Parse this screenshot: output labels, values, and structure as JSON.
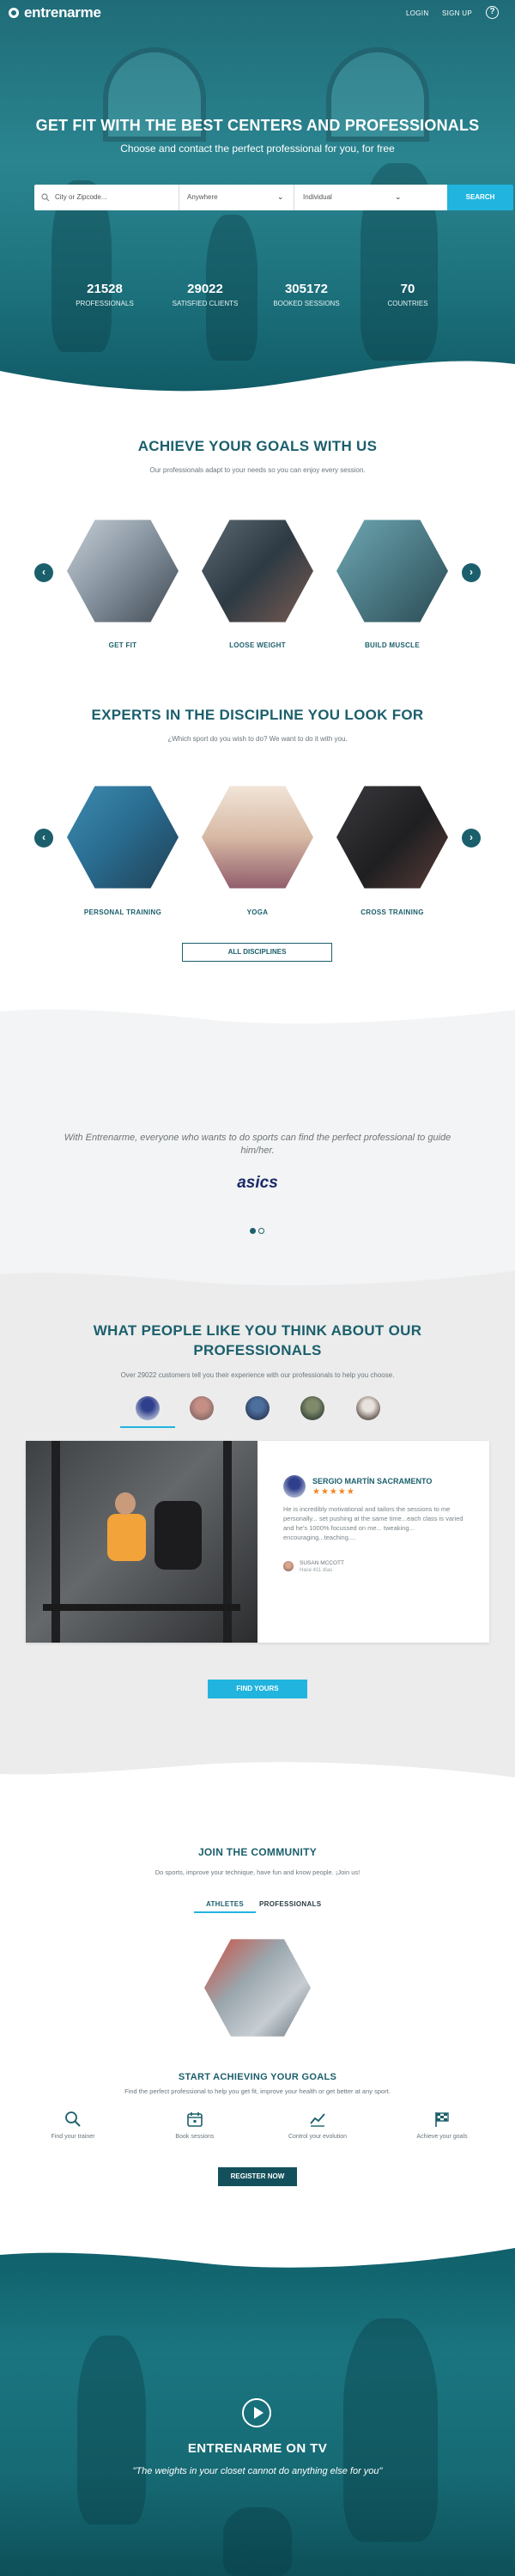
{
  "nav": {
    "logo": "entrenarme",
    "login": "LOGIN",
    "signup": "SIGN UP",
    "help": "?"
  },
  "hero": {
    "title": "GET FIT WITH THE BEST CENTERS AND PROFESSIONALS",
    "subtitle": "Choose and contact the perfect professional for you, for free",
    "search": {
      "location_placeholder": "City or Zipcode...",
      "place_value": "Anywhere",
      "type_value": "Individual",
      "button": "SEARCH"
    },
    "stats": [
      {
        "value": "21528",
        "label": "PROFESSIONALS"
      },
      {
        "value": "29022",
        "label": "SATISFIED CLIENTS"
      },
      {
        "value": "305172",
        "label": "BOOKED SESSIONS"
      },
      {
        "value": "70",
        "label": "COUNTRIES"
      }
    ]
  },
  "goals": {
    "title": "ACHIEVE YOUR GOALS WITH US",
    "subtitle": "Our professionals adapt to your needs so you can enjoy every session.",
    "items": [
      {
        "label": "GET FIT"
      },
      {
        "label": "LOOSE WEIGHT"
      },
      {
        "label": "BUILD MUSCLE"
      }
    ]
  },
  "disciplines": {
    "title": "EXPERTS IN THE DISCIPLINE YOU LOOK FOR",
    "subtitle": "¿Which sport do you wish to do? We want to do it with you.",
    "items": [
      {
        "label": "PERSONAL TRAINING"
      },
      {
        "label": "YOGA"
      },
      {
        "label": "CROSS TRAINING"
      }
    ],
    "button": "ALL DISCIPLINES"
  },
  "partner": {
    "quote": "With Entrenarme, everyone who wants to do sports can find the perfect professional to guide him/her.",
    "logo_text": "asics"
  },
  "testimonials": {
    "title_line1": "WHAT PEOPLE LIKE YOU THINK ABOUT OUR",
    "title_line2": "PROFESSIONALS",
    "subtitle": "Over 29022 customers tell you their experience with our professionals to help you choose.",
    "trainer_name": "SERGIO MARTÍN SACRAMENTO",
    "stars": "★★★★★",
    "review": "He is incredibly motivational and tailors the sessions to me personally... set pushing at the same time...each class is varied and he's 1000% focussed on me... tweaking... encouraging...teaching....",
    "client_name": "SUSAN MCCOTT",
    "client_meta": "Hace 411 días",
    "button": "FIND YOURS"
  },
  "community": {
    "title": "JOIN THE COMMUNITY",
    "subtitle": "Do sports, improve your technique, have fun and know people. ¡Join us!",
    "tabs": [
      {
        "label": "ATHLETES"
      },
      {
        "label": "PROFESSIONALS"
      }
    ],
    "cta_title": "START ACHIEVING YOUR GOALS",
    "cta_sub": "Find the perfect professional to help you get fit, improve your health or get better at any sport.",
    "features": [
      {
        "icon": "search-icon",
        "label": "Find your trainer"
      },
      {
        "icon": "calendar-icon",
        "label": "Book sessions"
      },
      {
        "icon": "chart-icon",
        "label": "Control your evolution"
      },
      {
        "icon": "flag-icon",
        "label": "Achieve your goals"
      }
    ],
    "button": "REGISTER NOW"
  },
  "tv": {
    "title": "ENTRENARME ON TV",
    "quote": "\"The weights in your closet cannot do anything else for you\""
  },
  "colors": {
    "primary": "#1b5f6c",
    "accent": "#21b4df",
    "dark_button": "#14505b",
    "star": "#f4841f"
  }
}
